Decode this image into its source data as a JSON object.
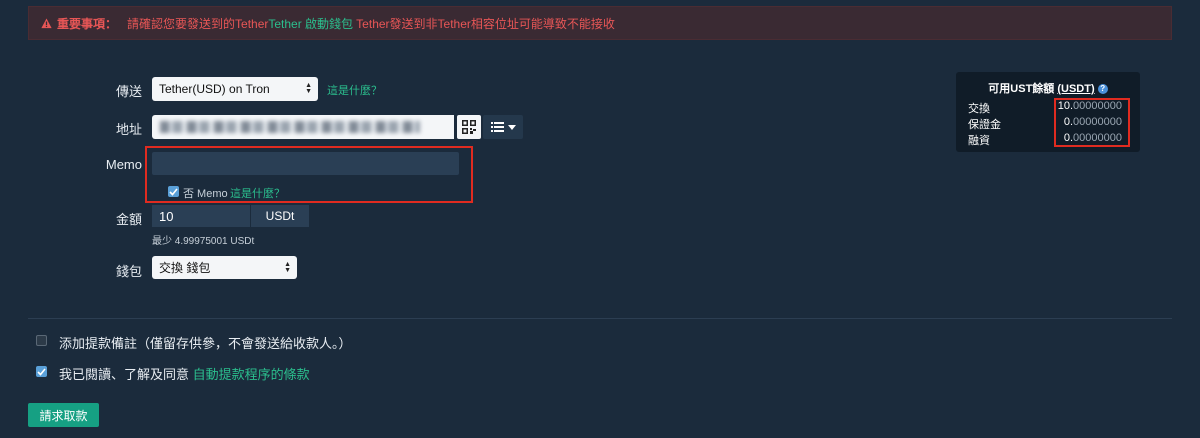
{
  "warning": {
    "title": "重要事項：",
    "text_before": "請確認您要發送到的Tether",
    "text_accent": "Tether 啟動錢包",
    "text_after": " Tether發送到非Tether相容位址可能導致不能接收"
  },
  "form": {
    "send_label": "傳送",
    "currency_value": "Tether(USD) on Tron",
    "currency_help": "這是什麼？",
    "address_label": "地址",
    "memo_label": "Memo",
    "memo_value": "",
    "no_memo_checked": true,
    "no_memo_label": "否 Memo",
    "no_memo_help": "這是什麼？",
    "amount_label": "金額",
    "amount_value": "10",
    "amount_unit": "USDt",
    "minimum_text": "最少 4.99975001 USDt",
    "wallet_label": "錢包",
    "wallet_value": "交換 錢包"
  },
  "balance": {
    "title": "可用UST餘額",
    "unit": "(USDT)",
    "rows": [
      {
        "label": "交換",
        "int": "10.",
        "dec": "00000000"
      },
      {
        "label": "保證金",
        "int": "0.",
        "dec": "00000000"
      },
      {
        "label": "融資",
        "int": "0.",
        "dec": "00000000"
      }
    ]
  },
  "options": {
    "note_checked": false,
    "note_label": "添加提款備註（僅留存供參，不會發送給收款人。）",
    "agree_checked": true,
    "agree_label": "我已閱讀、了解及同意 ",
    "agree_link": "自動提款程序的條款"
  },
  "submit_label": "請求取款",
  "colors": {
    "background": "#1b2b3c",
    "warning_text": "#e85656",
    "accent_green": "#2bbf8e",
    "highlight_red": "#e02b20",
    "button_green": "#16a083"
  },
  "icons": [
    "warning-icon",
    "select-arrows-icon",
    "qr-code-icon",
    "list-icon",
    "caret-down-icon",
    "question-icon",
    "check-icon"
  ]
}
